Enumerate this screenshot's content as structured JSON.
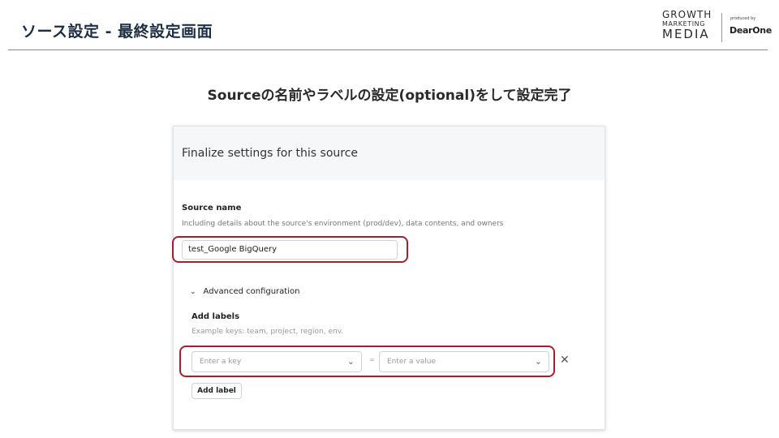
{
  "slide": {
    "title": "ソース設定 - 最終設定画面",
    "subtitle": "Sourceの名前やラベルの設定(optional)をして設定完了"
  },
  "logo": {
    "line1": "GROWTH",
    "line2": "MARKETING",
    "line3": "MEDIA",
    "produced_by": "produced by",
    "brand": "DearOne"
  },
  "panel": {
    "title": "Finalize settings for this source",
    "source_name": {
      "label": "Source name",
      "help": "Including details about the source's environment (prod/dev), data contents, and owners",
      "value": "test_Google BigQuery"
    },
    "advanced": {
      "toggle_label": "Advanced configuration",
      "labels_title": "Add labels",
      "labels_help": "Example keys: team, project, region, env.",
      "key_placeholder": "Enter a key",
      "separator": "=",
      "value_placeholder": "Enter a value",
      "add_label_button": "Add label"
    }
  },
  "colors": {
    "highlight": "#a81e2a",
    "title": "#1d2e44"
  },
  "icons": {
    "chevron": "chevron-down-icon",
    "close": "close-icon"
  }
}
